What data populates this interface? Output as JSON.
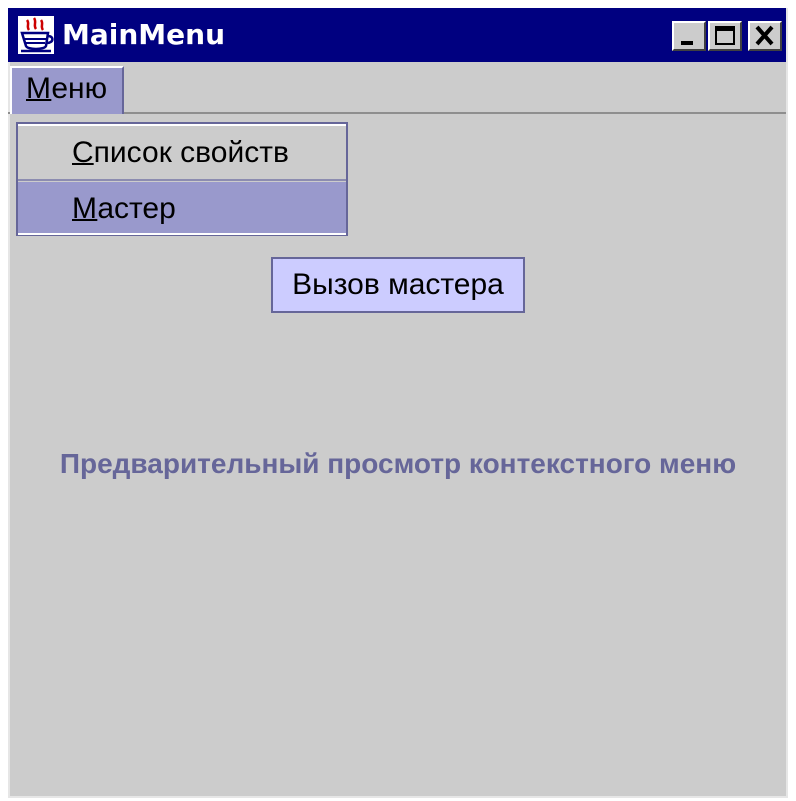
{
  "window": {
    "title": "MainMenu",
    "app_icon": "java-coffee-cup-icon",
    "controls": [
      "minimize-icon",
      "maximize-icon",
      "close-icon"
    ]
  },
  "menubar": {
    "menu_label": "Меню",
    "menu_mnemonic": "М",
    "menu_rest": "еню"
  },
  "popup_menu": {
    "items": [
      {
        "mnemonic": "С",
        "rest": "писок свойств",
        "label": "Список свойств",
        "selected": false
      },
      {
        "mnemonic": "М",
        "rest": "астер",
        "label": "Мастер",
        "selected": true
      }
    ]
  },
  "tooltip": {
    "text": "Вызов мастера"
  },
  "content": {
    "preview_text": "Предварительный просмотр контекстного меню"
  },
  "colors": {
    "titlebar": "#000080",
    "selection": "#9999cc",
    "tooltip_bg": "#ccccff",
    "preview_text": "#666699",
    "background": "#cccccc"
  }
}
